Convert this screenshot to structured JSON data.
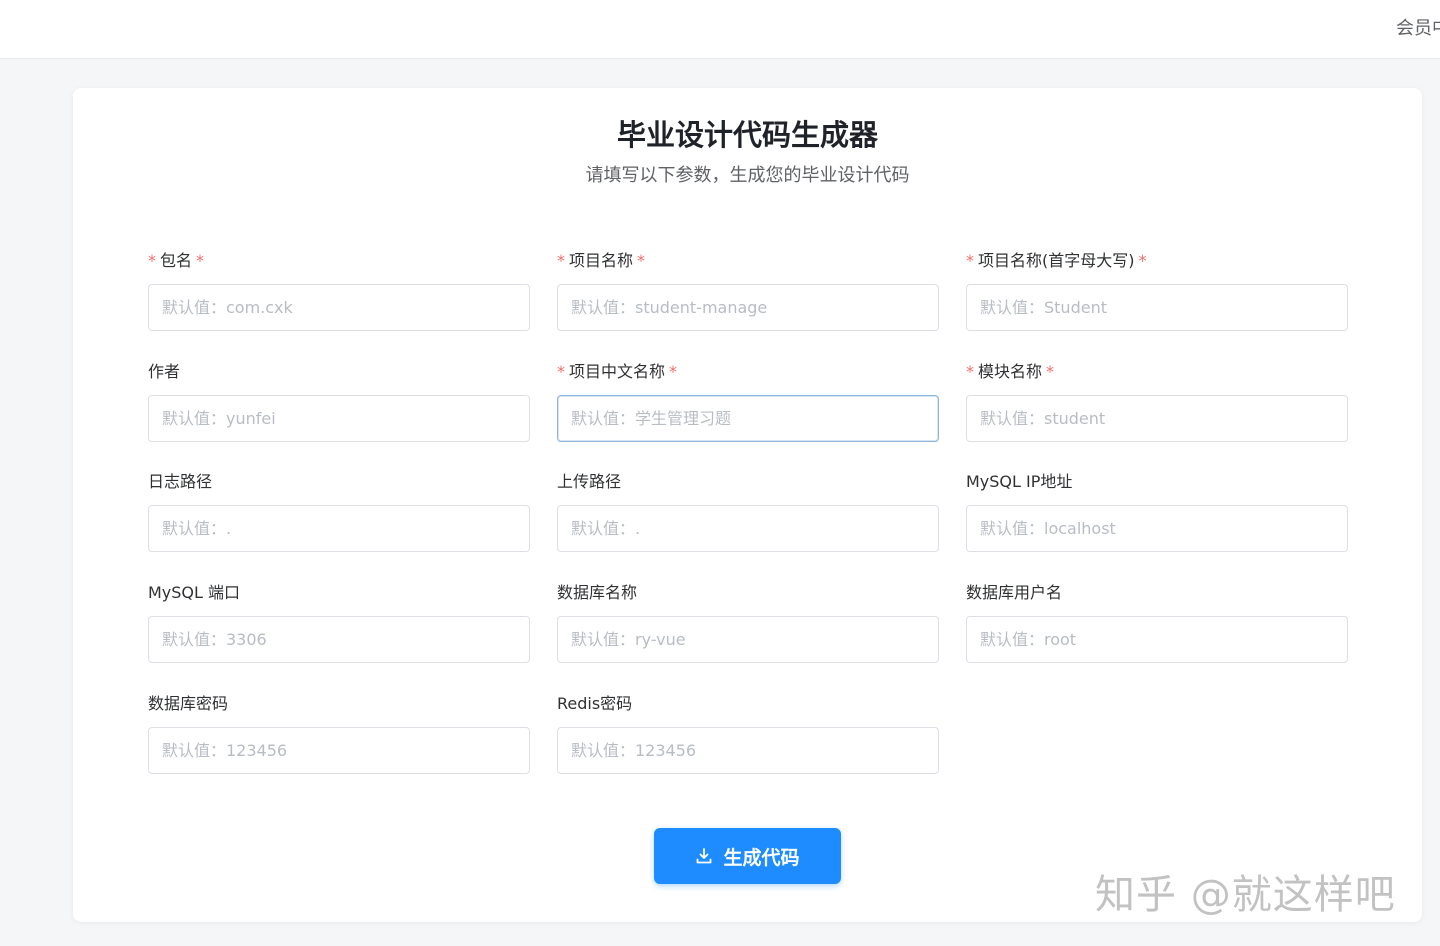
{
  "topbar": {
    "user_text": "会员中"
  },
  "header": {
    "title": "毕业设计代码生成器",
    "subtitle": "请填写以下参数，生成您的毕业设计代码"
  },
  "fields": [
    {
      "label": "包名",
      "required": true,
      "placeholder": "默认值：com.cxk"
    },
    {
      "label": "项目名称",
      "required": true,
      "placeholder": "默认值：student-manage"
    },
    {
      "label": "项目名称(首字母大写)",
      "required": true,
      "placeholder": "默认值：Student"
    },
    {
      "label": "作者",
      "required": false,
      "placeholder": "默认值：yunfei"
    },
    {
      "label": "项目中文名称",
      "required": true,
      "placeholder": "默认值：学生管理习题"
    },
    {
      "label": "模块名称",
      "required": true,
      "placeholder": "默认值：student"
    },
    {
      "label": "日志路径",
      "required": false,
      "placeholder": "默认值：."
    },
    {
      "label": "上传路径",
      "required": false,
      "placeholder": "默认值：."
    },
    {
      "label": "MySQL IP地址",
      "required": false,
      "placeholder": "默认值：localhost"
    },
    {
      "label": "MySQL 端口",
      "required": false,
      "placeholder": "默认值：3306"
    },
    {
      "label": "数据库名称",
      "required": false,
      "placeholder": "默认值：ry-vue"
    },
    {
      "label": "数据库用户名",
      "required": false,
      "placeholder": "默认值：root"
    },
    {
      "label": "数据库密码",
      "required": false,
      "placeholder": "默认值：123456"
    },
    {
      "label": "Redis密码",
      "required": false,
      "placeholder": "默认值：123456"
    }
  ],
  "required_mark": "*",
  "button": {
    "label": "生成代码",
    "icon": "download-icon"
  },
  "watermark": "知乎 @就这样吧",
  "colors": {
    "primary": "#1e8cff",
    "required": "#f56c6c"
  }
}
